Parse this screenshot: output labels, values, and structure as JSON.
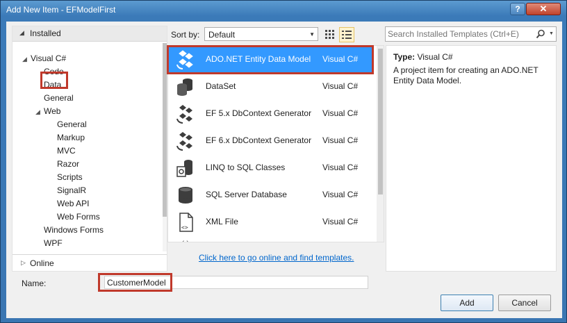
{
  "window": {
    "title": "Add New Item - EFModelFirst",
    "help_label": "?",
    "close_label": "✕"
  },
  "tree": {
    "installed_label": "Installed",
    "online_label": "Online",
    "items": [
      {
        "label": "Visual C#"
      },
      {
        "label": "Code"
      },
      {
        "label": "Data"
      },
      {
        "label": "General"
      },
      {
        "label": "Web"
      },
      {
        "label": "General"
      },
      {
        "label": "Markup"
      },
      {
        "label": "MVC"
      },
      {
        "label": "Razor"
      },
      {
        "label": "Scripts"
      },
      {
        "label": "SignalR"
      },
      {
        "label": "Web API"
      },
      {
        "label": "Web Forms"
      },
      {
        "label": "Windows Forms"
      },
      {
        "label": "WPF"
      }
    ]
  },
  "toolbar": {
    "sort_label": "Sort by:",
    "sort_value": "Default"
  },
  "search": {
    "placeholder": "Search Installed Templates (Ctrl+E)"
  },
  "templates": [
    {
      "name": "ADO.NET Entity Data Model",
      "lang": "Visual C#",
      "icon": "entity-model-icon",
      "selected": true
    },
    {
      "name": "DataSet",
      "lang": "Visual C#",
      "icon": "dataset-icon"
    },
    {
      "name": "EF 5.x DbContext Generator",
      "lang": "Visual C#",
      "icon": "ef-generator-icon"
    },
    {
      "name": "EF 6.x DbContext Generator",
      "lang": "Visual C#",
      "icon": "ef-generator-icon"
    },
    {
      "name": "LINQ to SQL Classes",
      "lang": "Visual C#",
      "icon": "linq-to-sql-icon"
    },
    {
      "name": "SQL Server Database",
      "lang": "Visual C#",
      "icon": "database-icon"
    },
    {
      "name": "XML File",
      "lang": "Visual C#",
      "icon": "xml-file-icon"
    }
  ],
  "online_link": "Click here to go online and find templates.",
  "details": {
    "type_key": "Type:",
    "type_value": "Visual C#",
    "description": "A project item for creating an ADO.NET Entity Data Model."
  },
  "name_field": {
    "label": "Name:",
    "value": "CustomerModel"
  },
  "buttons": {
    "add": "Add",
    "cancel": "Cancel"
  },
  "colors": {
    "selection": "#3399ff",
    "annotation": "#c0392b",
    "link": "#0066cc"
  }
}
